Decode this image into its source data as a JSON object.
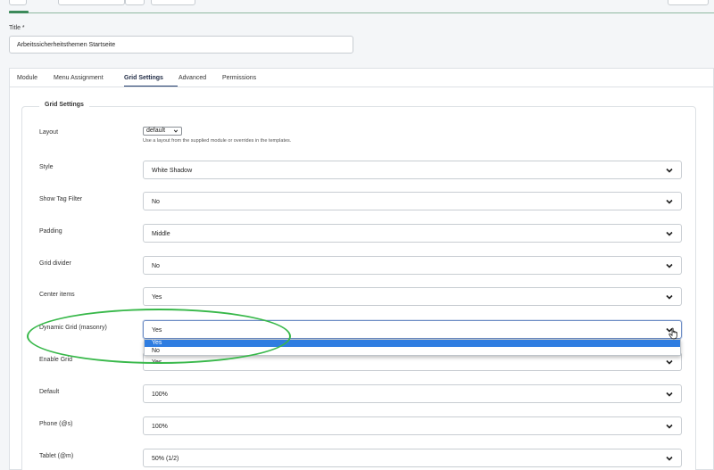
{
  "title_field": {
    "label": "Title *",
    "value": "Arbeitssicherheitsthemen Startseite"
  },
  "tabs": [
    {
      "label": "Module"
    },
    {
      "label": "Menu Assignment"
    },
    {
      "label": "Grid Settings",
      "active": true
    },
    {
      "label": "Advanced"
    },
    {
      "label": "Permissions"
    }
  ],
  "fieldset": {
    "legend": "Grid Settings"
  },
  "layout": {
    "label": "Layout",
    "value": "default",
    "hint": "Use a layout from the supplied module or overrides in the templates."
  },
  "fields": [
    {
      "label": "Style",
      "value": "White Shadow"
    },
    {
      "label": "Show Tag Filter",
      "value": "No"
    },
    {
      "label": "Padding",
      "value": "Middle"
    },
    {
      "label": "Grid divider",
      "value": "No"
    },
    {
      "label": "Center items",
      "value": "Yes"
    },
    {
      "label": "Dynamic Grid (masonry)",
      "value": "Yes"
    },
    {
      "label": "Enable Grid",
      "value": "Yes"
    },
    {
      "label": "Default",
      "value": "100%"
    },
    {
      "label": "Phone (@s)",
      "value": "100%"
    },
    {
      "label": "Tablet (@m)",
      "value": "50% (1/2)"
    }
  ],
  "dropdown_options": [
    "Yes",
    "No"
  ],
  "colors": {
    "active_tab": "#1f3a6b",
    "dropdown_highlight": "#2f7de1",
    "annotation": "#38b84a"
  }
}
